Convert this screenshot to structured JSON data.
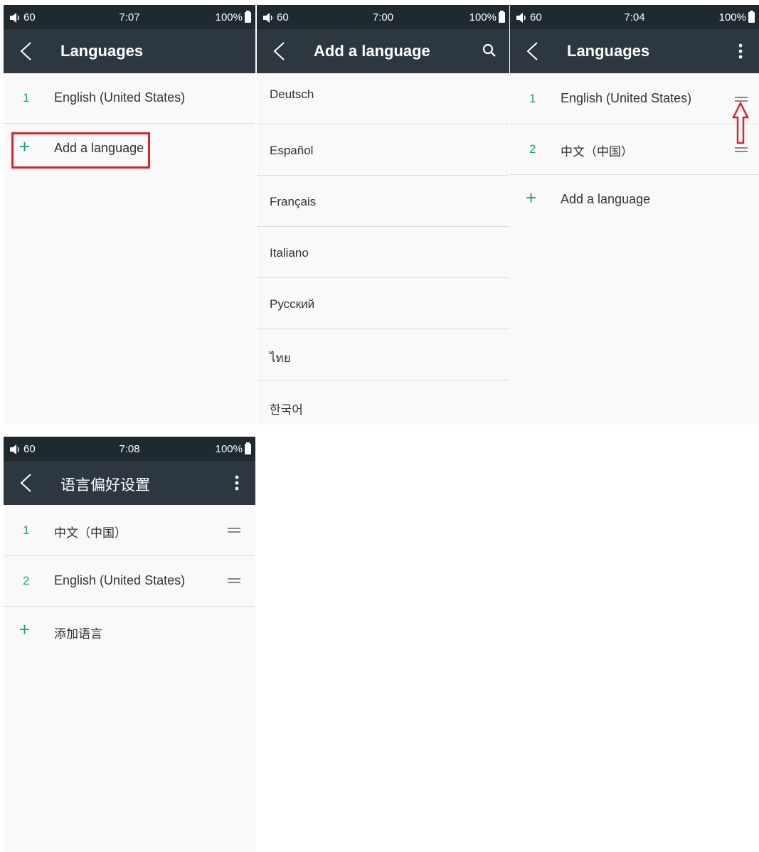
{
  "panel1": {
    "status": {
      "volume": "60",
      "time": "7:07",
      "battery": "100%"
    },
    "title": "Languages",
    "rows": [
      {
        "num": "1",
        "label": "English (United States)"
      }
    ],
    "add_label": "Add a language"
  },
  "panel2": {
    "status": {
      "volume": "60",
      "time": "7:00",
      "battery": "100%"
    },
    "title": "Add a language",
    "languages": [
      "Deutsch",
      "Español",
      "Français",
      "Italiano",
      "Русский",
      "ไทย",
      "한국어"
    ]
  },
  "panel3": {
    "status": {
      "volume": "60",
      "time": "7:04",
      "battery": "100%"
    },
    "title": "Languages",
    "rows": [
      {
        "num": "1",
        "label": "English (United States)"
      },
      {
        "num": "2",
        "label": "中文（中国）"
      }
    ],
    "add_label": "Add a language"
  },
  "panel4": {
    "status": {
      "volume": "60",
      "time": "7:08",
      "battery": "100%"
    },
    "title": "语言偏好设置",
    "rows": [
      {
        "num": "1",
        "label": "中文（中国）"
      },
      {
        "num": "2",
        "label": "English (United States)"
      }
    ],
    "add_label": "添加语言"
  },
  "colors": {
    "accent": "#1b9e87",
    "appbar": "#2c373f",
    "statusbar": "#1f2930",
    "highlight": "#e0222b"
  },
  "icons": [
    "volume-icon",
    "battery-icon",
    "back-arrow-icon",
    "search-icon",
    "more-vert-icon",
    "drag-handle-icon",
    "plus-icon",
    "up-arrow-annotation-icon"
  ]
}
